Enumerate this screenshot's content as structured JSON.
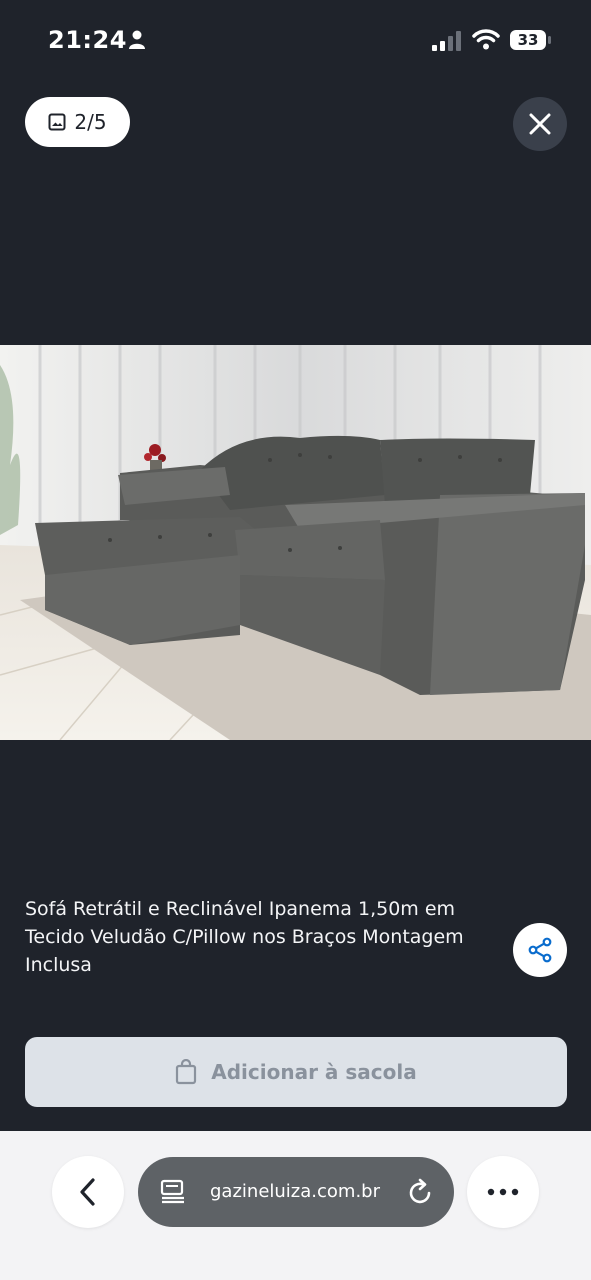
{
  "status_bar": {
    "time": "21:24",
    "battery": "33",
    "icons": [
      "person-icon",
      "signal-icon",
      "wifi-icon",
      "battery-icon"
    ]
  },
  "gallery": {
    "counter": "2/5",
    "icon": "image-icon",
    "close_icon": "close-icon"
  },
  "product": {
    "title": "Sofá Retrátil e Reclinável Ipanema 1,50m em Tecido Veludão C/Pillow nos Braços Montagem Inclusa",
    "share_icon": "share-icon"
  },
  "cart": {
    "label": "Adicionar à sacola",
    "icon": "shopping-bag-icon"
  },
  "browser": {
    "url": "gazineluiza.com.br",
    "back_icon": "chevron-left-icon",
    "page_icon": "page-icon",
    "reload_icon": "reload-icon",
    "more_icon": "more-icon"
  },
  "colors": {
    "background": "#1f232b",
    "button_disabled": "#dde2e8",
    "share_accent": "#0a6ccd"
  }
}
